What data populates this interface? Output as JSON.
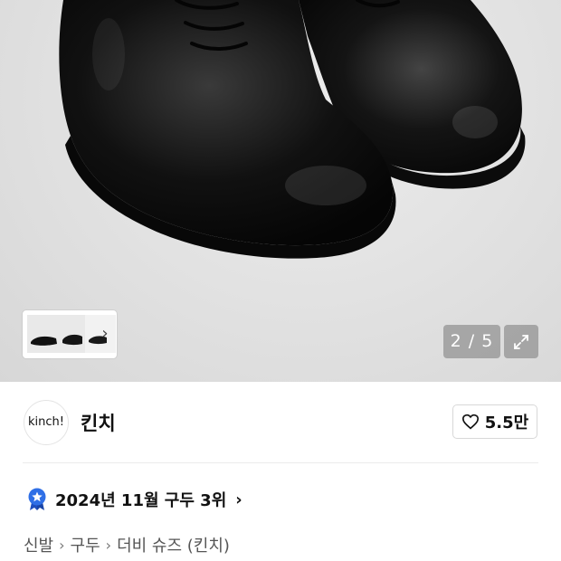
{
  "gallery": {
    "counter": "2 / 5",
    "thumbnails": [
      {
        "icon": "shoe-thumbnail"
      },
      {
        "icon": "shoe-thumbnail"
      },
      {
        "icon": "shoe-thumbnail"
      }
    ],
    "thumb_next_icon": "chevron-right-icon",
    "expand_icon": "expand-icon"
  },
  "brand": {
    "logo_text": "kinch!",
    "name": "킨치",
    "like_count": "5.5만",
    "like_icon": "heart-icon"
  },
  "ranking": {
    "text": "2024년 11월 구두 3위",
    "badge_icon": "star-badge-icon",
    "badge_color": "#2f6fe6"
  },
  "breadcrumb": {
    "items": [
      "신발",
      "구두",
      "더비 슈즈 (킨치)"
    ]
  }
}
